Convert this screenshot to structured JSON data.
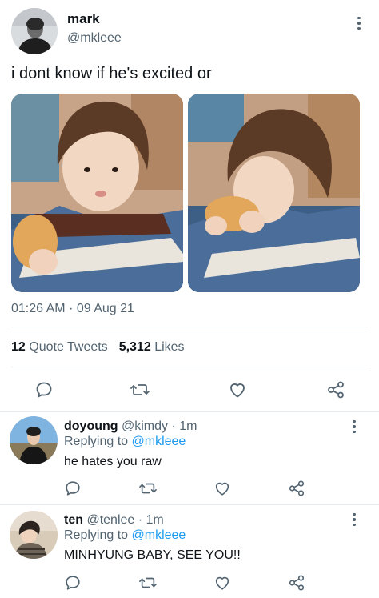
{
  "tweet": {
    "author_name": "mark",
    "author_handle": "@mkleee",
    "text": "i dont know if he's excited or",
    "time": "01:26 AM",
    "separator": "·",
    "date": "09 Aug 21",
    "quote_count": "12",
    "quote_label": "Quote Tweets",
    "like_count": "5,312",
    "like_label": "Likes"
  },
  "replies": [
    {
      "name": "doyoung",
      "handle": "@kimdy",
      "time": "· 1m",
      "replying_prefix": "Replying to",
      "replying_to": "@mkleee",
      "text": "he hates you raw"
    },
    {
      "name": "ten",
      "handle": "@tenlee",
      "time": "· 1m",
      "replying_prefix": "Replying to",
      "replying_to": "@mkleee",
      "text": "MINHYUNG BABY, SEE YOU!!"
    }
  ],
  "icons": {
    "reply": "reply-icon",
    "retweet": "retweet-icon",
    "like": "like-icon",
    "share": "share-icon",
    "more": "more-icon"
  },
  "colors": {
    "text": "#0f1419",
    "secondary": "#536471",
    "link": "#1d9bf0",
    "divider": "#e6ecf0"
  }
}
